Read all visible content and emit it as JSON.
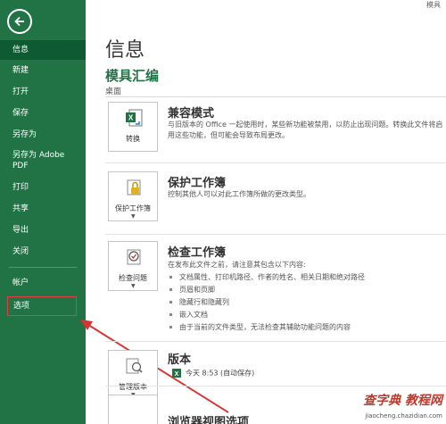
{
  "window": {
    "top_right_label": "模具"
  },
  "sidebar": {
    "items": [
      {
        "label": "信息",
        "selected": true
      },
      {
        "label": "新建"
      },
      {
        "label": "打开"
      },
      {
        "label": "保存"
      },
      {
        "label": "另存为"
      },
      {
        "label": "另存为 Adobe PDF"
      },
      {
        "label": "打印"
      },
      {
        "label": "共享"
      },
      {
        "label": "导出"
      },
      {
        "label": "关闭"
      },
      {
        "label": "帐户"
      },
      {
        "label": "选项"
      }
    ]
  },
  "main": {
    "title": "信息",
    "doc_name": "模具汇编",
    "doc_location": "桌面",
    "sections": [
      {
        "button_label": "转换",
        "title": "兼容模式",
        "description": "与旧版本的 Office 一起使用时，某些新功能被禁用，以防止出现问题。转换此文件将启用这些功能，但可能会导致布局更改。"
      },
      {
        "button_label": "保护工作簿",
        "title": "保护工作簿",
        "description": "控制其他人可以对此工作簿所做的更改类型。"
      },
      {
        "button_label": "检查问题",
        "title": "检查工作簿",
        "description": "在发布此文件之前，请注意其包含以下内容:",
        "bullets": [
          "文档属性、打印机路径、作者的姓名、相关日期和绝对路径",
          "页眉和页脚",
          "隐藏行和隐藏列",
          "嵌入文档",
          "由于当前的文件类型，无法检查其辅助功能问题的内容"
        ]
      },
      {
        "button_label": "管理版本",
        "title": "版本",
        "version_entry": "今天 8:53 (自动保存)"
      },
      {
        "title": "浏览器视图选项"
      }
    ]
  },
  "watermark": {
    "brand": "查字典 教程网",
    "url": "jiaocheng.chazidian.com"
  },
  "colors": {
    "sidebar": "#217346",
    "selected": "#0e5a32",
    "accent_green": "#217346",
    "highlight_red": "#e0413f"
  }
}
